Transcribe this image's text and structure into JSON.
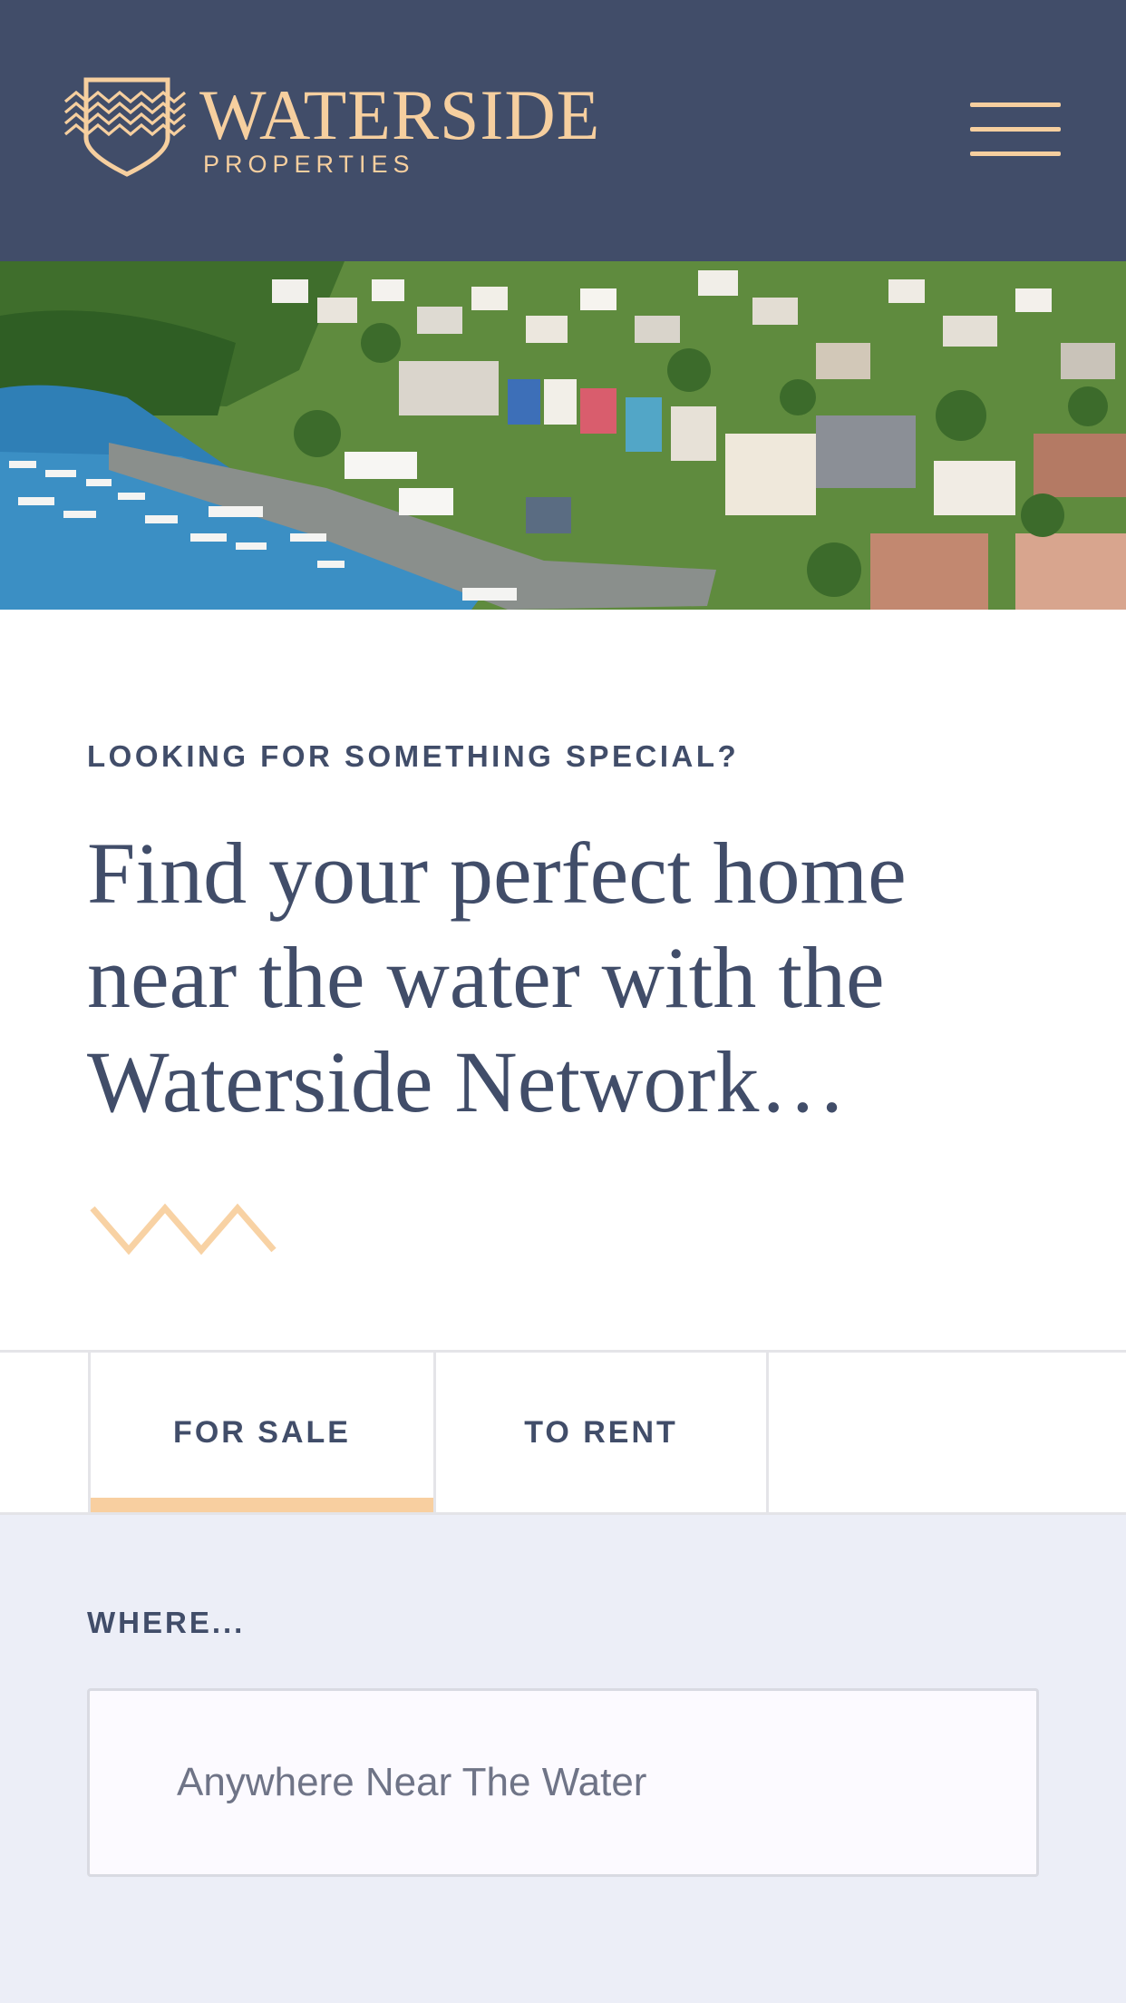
{
  "header": {
    "logo_title": "WATERSIDE",
    "logo_subtitle": "PROPERTIES",
    "menu_icon": "hamburger-menu-icon",
    "background_color": "#414d69",
    "accent_color": "#f6cf9f"
  },
  "hero": {
    "image": "harbour-town-aerial-photo"
  },
  "intro": {
    "eyebrow": "LOOKING FOR SOMETHING SPECIAL?",
    "headline": "Find your perfect home near the water with the Waterside Network…",
    "divider_icon": "wave-icon"
  },
  "tabs": [
    {
      "label": "FOR SALE",
      "active": true
    },
    {
      "label": "TO RENT",
      "active": false
    }
  ],
  "search": {
    "where_label": "WHERE...",
    "where_placeholder": "Anywhere Near The Water",
    "where_value": ""
  }
}
